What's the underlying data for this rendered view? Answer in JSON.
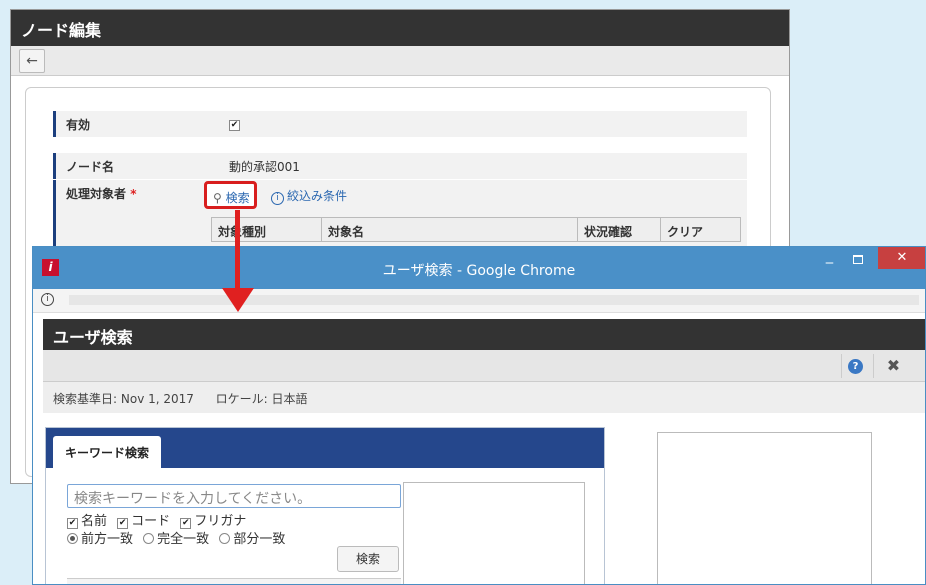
{
  "back_window": {
    "title": "ノード編集",
    "back_icon": "←",
    "rows": {
      "enabled_label": "有効",
      "enabled_check": "✔",
      "node_name_label": "ノード名",
      "node_name_value": "動的承認001",
      "target_label": "処理対象者",
      "required_mark": "*"
    },
    "search_link": "検索",
    "search_icon": "⚲",
    "filter_link": "絞込み条件",
    "filter_icon": "i",
    "table_headers": [
      "対象種別",
      "対象名",
      "状況確認",
      "クリア"
    ]
  },
  "popup": {
    "window_title": "ユーザ検索 - Google Chrome",
    "logo": "i",
    "win_min": "‒",
    "win_close": "✕",
    "addr_info": "i",
    "page_title": "ユーザ検索",
    "help_icon": "?",
    "close_icon": "✖",
    "date_label": "検索基準日:",
    "date_value": "Nov 1, 2017",
    "locale_label": "ロケール:",
    "locale_value": "日本語",
    "keyword_tab": "キーワード検索",
    "keyword_placeholder": "検索キーワードを入力してください。",
    "check_mark": "✔",
    "checks": [
      "名前",
      "コード",
      "フリガナ"
    ],
    "radios": [
      "前方一致",
      "完全一致",
      "部分一致"
    ],
    "search_button": "検索"
  },
  "colors": {
    "highlight": "#d81e1e",
    "arrow": "#e02020",
    "chrome_bar": "#4a90c8",
    "panel_header": "#25478c"
  }
}
